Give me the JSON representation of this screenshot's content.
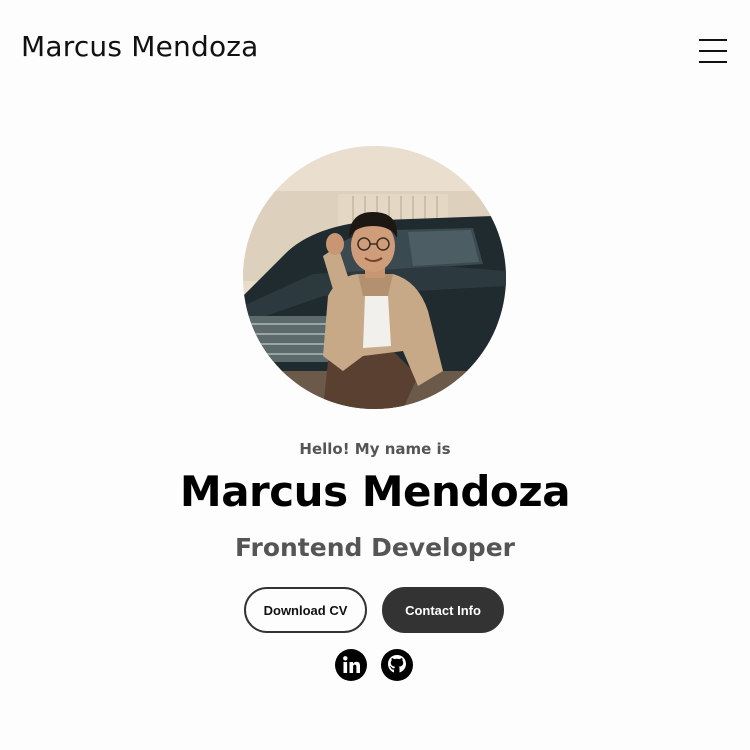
{
  "nav": {
    "logo": "Marcus Mendoza",
    "menu_icon": "hamburger-menu-icon"
  },
  "profile": {
    "image": "profile-photo"
  },
  "hero": {
    "greeting": "Hello! My name is",
    "name": "Marcus Mendoza",
    "role": "Frontend Developer"
  },
  "buttons": {
    "download_cv": "Download CV",
    "contact_info": "Contact Info"
  },
  "social": [
    {
      "icon": "linkedin-icon"
    },
    {
      "icon": "github-icon"
    }
  ],
  "colors": {
    "background": "#fdfdfd",
    "text": "#111111",
    "muted": "#555555",
    "button_dark": "#333333"
  }
}
